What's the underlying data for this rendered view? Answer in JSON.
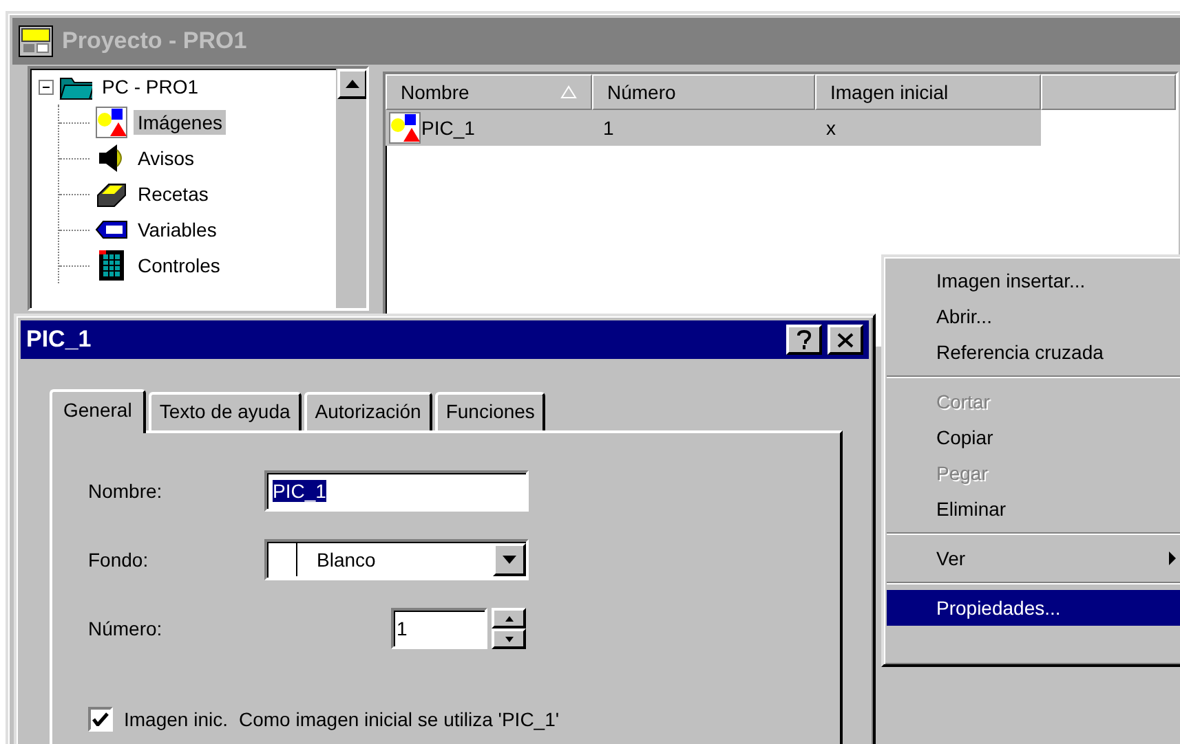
{
  "project_window": {
    "title": "Proyecto - PRO1",
    "active": false
  },
  "tree": {
    "label": "PC - PRO1",
    "kind": "folder",
    "expanded": true,
    "children": [
      {
        "label": "Imágenes",
        "kind": "images",
        "selected": true
      },
      {
        "label": "Avisos",
        "kind": "alarms",
        "selected": false
      },
      {
        "label": "Recetas",
        "kind": "recipes",
        "selected": false
      },
      {
        "label": "Variables",
        "kind": "tags",
        "selected": false
      },
      {
        "label": "Controles",
        "kind": "controls",
        "selected": false
      }
    ]
  },
  "list": {
    "columns": [
      {
        "label": "Nombre",
        "sorted": true
      },
      {
        "label": "Número",
        "sorted": false
      },
      {
        "label": "Imagen inicial",
        "sorted": false
      }
    ],
    "rows": [
      {
        "cells": [
          "PIC_1",
          "1",
          "x"
        ],
        "selected": true
      }
    ]
  },
  "dialog": {
    "title": "PIC_1",
    "active": true,
    "tabs": [
      {
        "label": "General",
        "selected": true
      },
      {
        "label": "Texto de ayuda",
        "selected": false
      },
      {
        "label": "Autorización",
        "selected": false
      },
      {
        "label": "Funciones",
        "selected": false
      }
    ],
    "fields": [
      {
        "kind": "text",
        "label": "Nombre:",
        "value": "PIC_1",
        "text_selected": true
      },
      {
        "kind": "combo",
        "label": "Fondo:",
        "value": "Blanco"
      },
      {
        "kind": "spin",
        "label": "Número:",
        "value": "1"
      }
    ],
    "checkbox": {
      "label": "Imagen inic.",
      "checked": true,
      "note": "Como imagen inicial se utiliza 'PIC_1'"
    }
  },
  "context_menu": {
    "items": [
      {
        "kind": "item",
        "label": "Imagen insertar...",
        "disabled": false,
        "selected": false
      },
      {
        "kind": "item",
        "label": "Abrir...",
        "disabled": false,
        "selected": false
      },
      {
        "kind": "item",
        "label": "Referencia cruzada",
        "disabled": false,
        "selected": false
      },
      {
        "kind": "separator"
      },
      {
        "kind": "item",
        "label": "Cortar",
        "disabled": true,
        "selected": false
      },
      {
        "kind": "item",
        "label": "Copiar",
        "disabled": false,
        "selected": false
      },
      {
        "kind": "item",
        "label": "Pegar",
        "disabled": true,
        "selected": false
      },
      {
        "kind": "item",
        "label": "Eliminar",
        "disabled": false,
        "selected": false
      },
      {
        "kind": "separator"
      },
      {
        "kind": "submenu",
        "label": "Ver",
        "disabled": false,
        "selected": false
      },
      {
        "kind": "separator"
      },
      {
        "kind": "item",
        "label": "Propiedades...",
        "disabled": false,
        "selected": true
      }
    ]
  }
}
